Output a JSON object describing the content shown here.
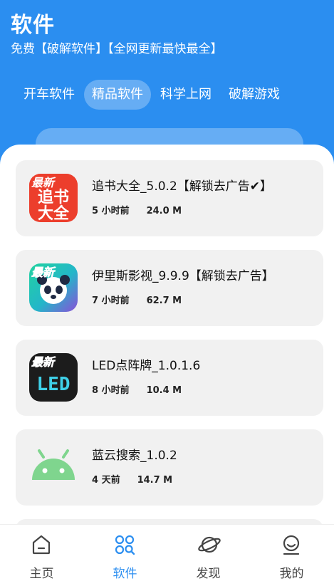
{
  "header": {
    "title": "软件",
    "subtitle": "免费【破解软件】【全网更新最快最全】"
  },
  "tabs": [
    {
      "label": "开车软件",
      "active": false
    },
    {
      "label": "精品软件",
      "active": true
    },
    {
      "label": "科学上网",
      "active": false
    },
    {
      "label": "破解游戏",
      "active": false
    }
  ],
  "apps": [
    {
      "name": "追书大全_5.0.2【解锁去广告✔】",
      "time": "5 小时前",
      "size": "24.0 M",
      "icon": "zhuishu-app-icon",
      "badge": "最新",
      "icon_lines": [
        "追书",
        "大全"
      ]
    },
    {
      "name": "伊里斯影视_9.9.9【解锁去广告】",
      "time": "7 小时前",
      "size": "62.7 M",
      "icon": "panda-app-icon",
      "badge": "最新"
    },
    {
      "name": "LED点阵牌_1.0.1.6",
      "time": "8 小时前",
      "size": "10.4 M",
      "icon": "led-app-icon",
      "badge": "最新",
      "icon_text": "LED"
    },
    {
      "name": "蓝云搜索_1.0.2",
      "time": "4 天前",
      "size": "14.7 M",
      "icon": "android-app-icon"
    }
  ],
  "nav": [
    {
      "label": "主页",
      "icon": "home-icon",
      "active": false
    },
    {
      "label": "软件",
      "icon": "apps-grid-icon",
      "active": true
    },
    {
      "label": "发现",
      "icon": "planet-icon",
      "active": false
    },
    {
      "label": "我的",
      "icon": "smiley-icon",
      "active": false
    }
  ],
  "colors": {
    "header_blue": "#2b8ef0",
    "active_nav": "#2b8ef0",
    "card_bg": "#f1f1f1",
    "badge_red": "#e8332b"
  }
}
